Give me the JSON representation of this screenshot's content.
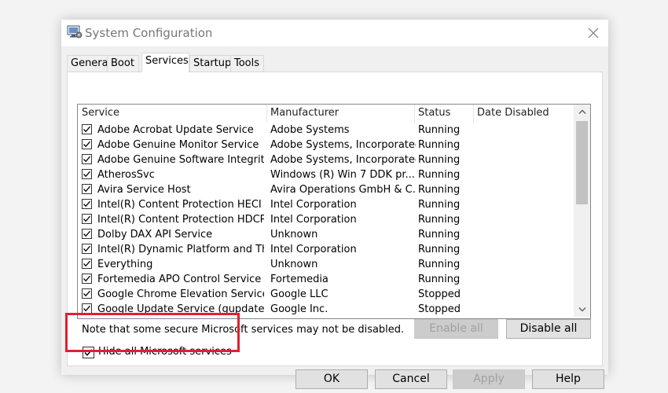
{
  "window": {
    "title": "System Configuration",
    "icon": "system-config-icon",
    "close_icon": "close-icon"
  },
  "tabs": [
    {
      "label": "General",
      "active": false
    },
    {
      "label": "Boot",
      "active": false
    },
    {
      "label": "Services",
      "active": true
    },
    {
      "label": "Startup",
      "active": false
    },
    {
      "label": "Tools",
      "active": false
    }
  ],
  "services_list": {
    "columns": [
      "Service",
      "Manufacturer",
      "Status",
      "Date Disabled"
    ],
    "rows": [
      {
        "service": "Adobe Acrobat Update Service",
        "manufacturer": "Adobe Systems",
        "status": "Running",
        "date_disabled": "",
        "checked": true
      },
      {
        "service": "Adobe Genuine Monitor Service",
        "manufacturer": "Adobe Systems, Incorporated",
        "status": "Running",
        "date_disabled": "",
        "checked": true
      },
      {
        "service": "Adobe Genuine Software Integrity...",
        "manufacturer": "Adobe Systems, Incorporated",
        "status": "Running",
        "date_disabled": "",
        "checked": true
      },
      {
        "service": "AtherosSvc",
        "manufacturer": "Windows (R) Win 7 DDK pr...",
        "status": "Running",
        "date_disabled": "",
        "checked": true
      },
      {
        "service": "Avira Service Host",
        "manufacturer": "Avira Operations GmbH & C...",
        "status": "Running",
        "date_disabled": "",
        "checked": true
      },
      {
        "service": "Intel(R) Content Protection HECI ...",
        "manufacturer": "Intel Corporation",
        "status": "Running",
        "date_disabled": "",
        "checked": true
      },
      {
        "service": "Intel(R) Content Protection HDCP ...",
        "manufacturer": "Intel Corporation",
        "status": "Running",
        "date_disabled": "",
        "checked": true
      },
      {
        "service": "Dolby DAX API Service",
        "manufacturer": "Unknown",
        "status": "Running",
        "date_disabled": "",
        "checked": true
      },
      {
        "service": "Intel(R) Dynamic Platform and Th...",
        "manufacturer": "Intel Corporation",
        "status": "Running",
        "date_disabled": "",
        "checked": true
      },
      {
        "service": "Everything",
        "manufacturer": "Unknown",
        "status": "Running",
        "date_disabled": "",
        "checked": true
      },
      {
        "service": "Fortemedia APO Control Service",
        "manufacturer": "Fortemedia",
        "status": "Running",
        "date_disabled": "",
        "checked": true
      },
      {
        "service": "Google Chrome Elevation Service",
        "manufacturer": "Google LLC",
        "status": "Stopped",
        "date_disabled": "",
        "checked": true
      },
      {
        "service": "Google Update Service (gupdate)",
        "manufacturer": "Google Inc.",
        "status": "Stopped",
        "date_disabled": "",
        "checked": true
      }
    ]
  },
  "note": "Note that some secure Microsoft services may not be disabled.",
  "enable_all_label": "Enable all",
  "disable_all_label": "Disable all",
  "hide_ms": {
    "label": "Hide all Microsoft services",
    "checked": true
  },
  "buttons": {
    "ok": "OK",
    "cancel": "Cancel",
    "apply": "Apply",
    "help": "Help"
  },
  "colors": {
    "highlight": "#e0202e",
    "disabled_text": "#a0a0a0"
  }
}
